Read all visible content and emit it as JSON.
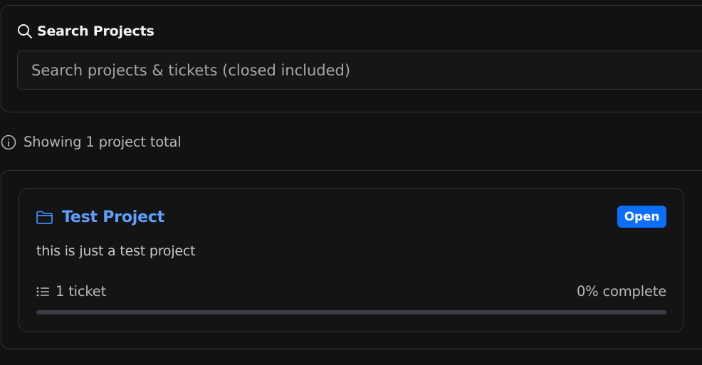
{
  "search": {
    "title": "Search Projects",
    "placeholder": "Search projects & tickets (closed included)",
    "value": ""
  },
  "summary": {
    "text": "Showing 1 project total"
  },
  "projects": [
    {
      "name": "Test Project",
      "status": "Open",
      "description": "this is just a test project",
      "tickets": "1 ticket",
      "progress_text": "0% complete",
      "progress": 0
    }
  ],
  "colors": {
    "background": "#121212",
    "accent": "#0d6efd",
    "link": "#5ea0ff",
    "border": "#343434"
  },
  "icons": {
    "search": "search-icon",
    "info": "info-icon",
    "folder": "folder-icon",
    "list": "list-icon"
  }
}
